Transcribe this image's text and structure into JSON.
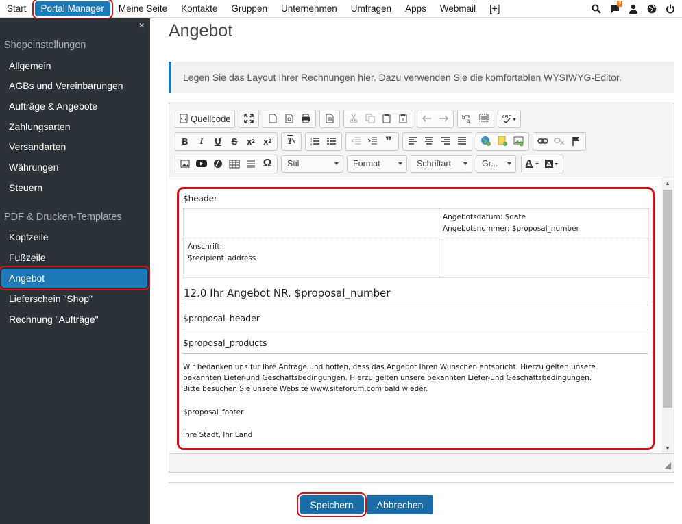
{
  "topnav": {
    "items": [
      {
        "label": "Start"
      },
      {
        "label": "Portal Manager"
      },
      {
        "label": "Meine Seite"
      },
      {
        "label": "Kontakte"
      },
      {
        "label": "Gruppen"
      },
      {
        "label": "Unternehmen"
      },
      {
        "label": "Umfragen"
      },
      {
        "label": "Apps"
      },
      {
        "label": "Webmail"
      },
      {
        "label": "[+]"
      }
    ],
    "icons": {
      "search": "search-icon",
      "messages": "chat-icon",
      "user": "user-icon",
      "globe": "globe-icon",
      "power": "power-icon"
    },
    "message_badge": "2"
  },
  "sidebar": {
    "close": "×",
    "sections": [
      {
        "title": "Shopeinstellungen",
        "items": [
          "Allgemein",
          "AGBs und Vereinbarungen",
          "Aufträge & Angebote",
          "Zahlungsarten",
          "Versandarten",
          "Währungen",
          "Steuern"
        ]
      },
      {
        "title": "PDF & Drucken-Templates",
        "items": [
          "Kopfzeile",
          "Fußzeile",
          "Angebot",
          "Lieferschein \"Shop\"",
          "Rechnung \"Aufträge\""
        ]
      }
    ],
    "active_item": "Angebot"
  },
  "page": {
    "title": "Angebot",
    "info": "Legen Sie das Layout Ihrer Rechnungen hier. Dazu verwenden Sie die komfortablen WYSIWYG-Editor."
  },
  "toolbar": {
    "source_label": "Quellcode",
    "combos": {
      "style": "Stil",
      "format": "Format",
      "font": "Schriftart",
      "size": "Gr..."
    }
  },
  "document": {
    "header_var": "$header",
    "date_line": "Angebotsdatum: $date",
    "number_line": "Angebotsnummer: $proposal_number",
    "address_label": "Anschrift:",
    "address_var": "$recipient_address",
    "heading": "12.0 Ihr Angebot NR. $proposal_number",
    "proposal_header": "$proposal_header",
    "proposal_products": "$proposal_products",
    "thanks_line1": "Wir bedanken uns für Ihre Anfrage und hoffen, dass das Angebot Ihren Wünschen entspricht. Hierzu gelten unsere",
    "thanks_line2": "bekannten Liefer-und Geschäftsbedingungen. Hierzu gelten unsere bekannten Liefer-und Geschäftsbedingungen.",
    "thanks_line3": "Bitte besuchen Sie unsere Website www.siteforum.com bald wieder.",
    "proposal_footer": "$proposal_footer",
    "city": "Ihre Stadt, Ihr Land"
  },
  "buttons": {
    "save": "Speichern",
    "cancel": "Abbrechen"
  },
  "colors": {
    "accent": "#1d7ab7",
    "sidebar_bg": "#2c3338",
    "highlight": "#d0141a",
    "badge": "#f47b20"
  }
}
